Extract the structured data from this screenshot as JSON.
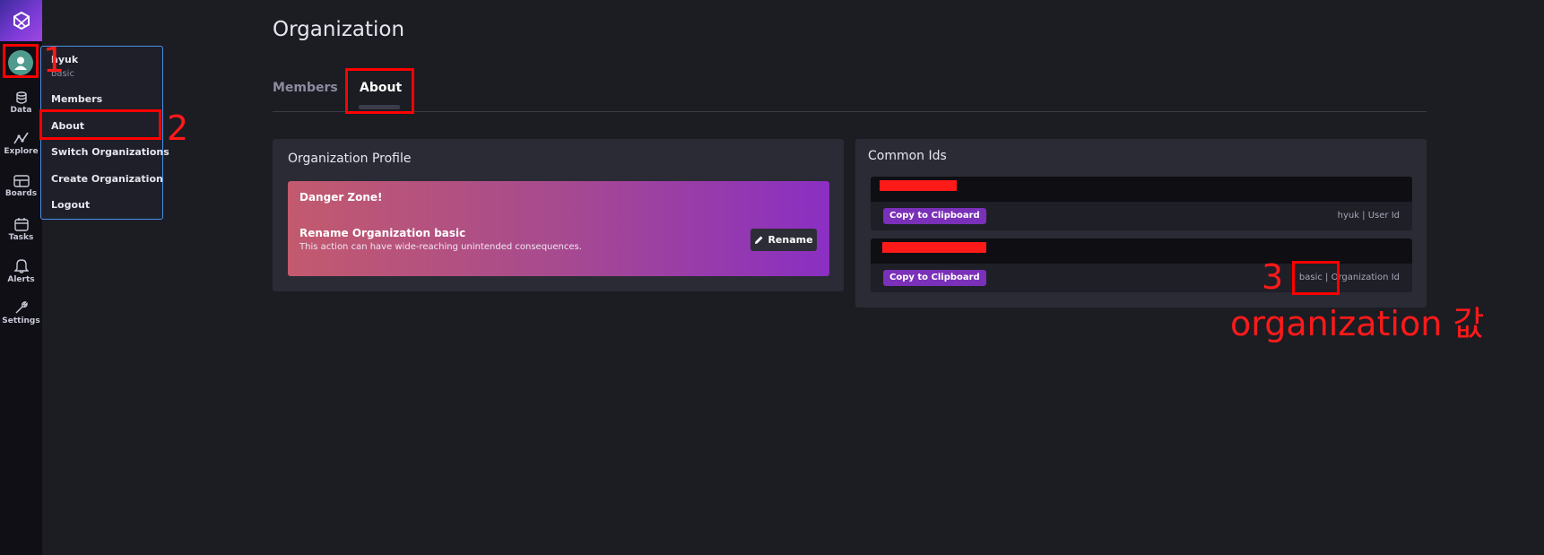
{
  "nav": {
    "items": [
      {
        "label": "Data",
        "icon": "database-icon"
      },
      {
        "label": "Explore",
        "icon": "graph-icon"
      },
      {
        "label": "Boards",
        "icon": "dashboard-icon"
      },
      {
        "label": "Tasks",
        "icon": "calendar-icon"
      },
      {
        "label": "Alerts",
        "icon": "bell-icon"
      },
      {
        "label": "Settings",
        "icon": "wrench-icon"
      }
    ]
  },
  "user_menu": {
    "username": "hyuk",
    "org": "basic",
    "items": [
      "Members",
      "About",
      "Switch Organizations",
      "Create Organization",
      "Logout"
    ]
  },
  "page": {
    "title": "Organization",
    "tabs": [
      "Members",
      "About"
    ]
  },
  "profile": {
    "title": "Organization Profile",
    "danger_title": "Danger Zone!",
    "rename_title": "Rename Organization basic",
    "rename_desc": "This action can have wide-reaching unintended consequences.",
    "rename_button": "Rename"
  },
  "common_ids": {
    "title": "Common Ids",
    "cards": [
      {
        "copy_label": "Copy to Clipboard",
        "label": "hyuk | User Id"
      },
      {
        "copy_label": "Copy to Clipboard",
        "label": "basic | Organization Id"
      }
    ]
  },
  "annotations": {
    "n1": "1",
    "n2": "2",
    "n3": "3",
    "note": "organization 값"
  },
  "colors": {
    "accent": "#7a30b8",
    "annotation": "#ff0000",
    "menu_border": "#4b8fe8"
  }
}
